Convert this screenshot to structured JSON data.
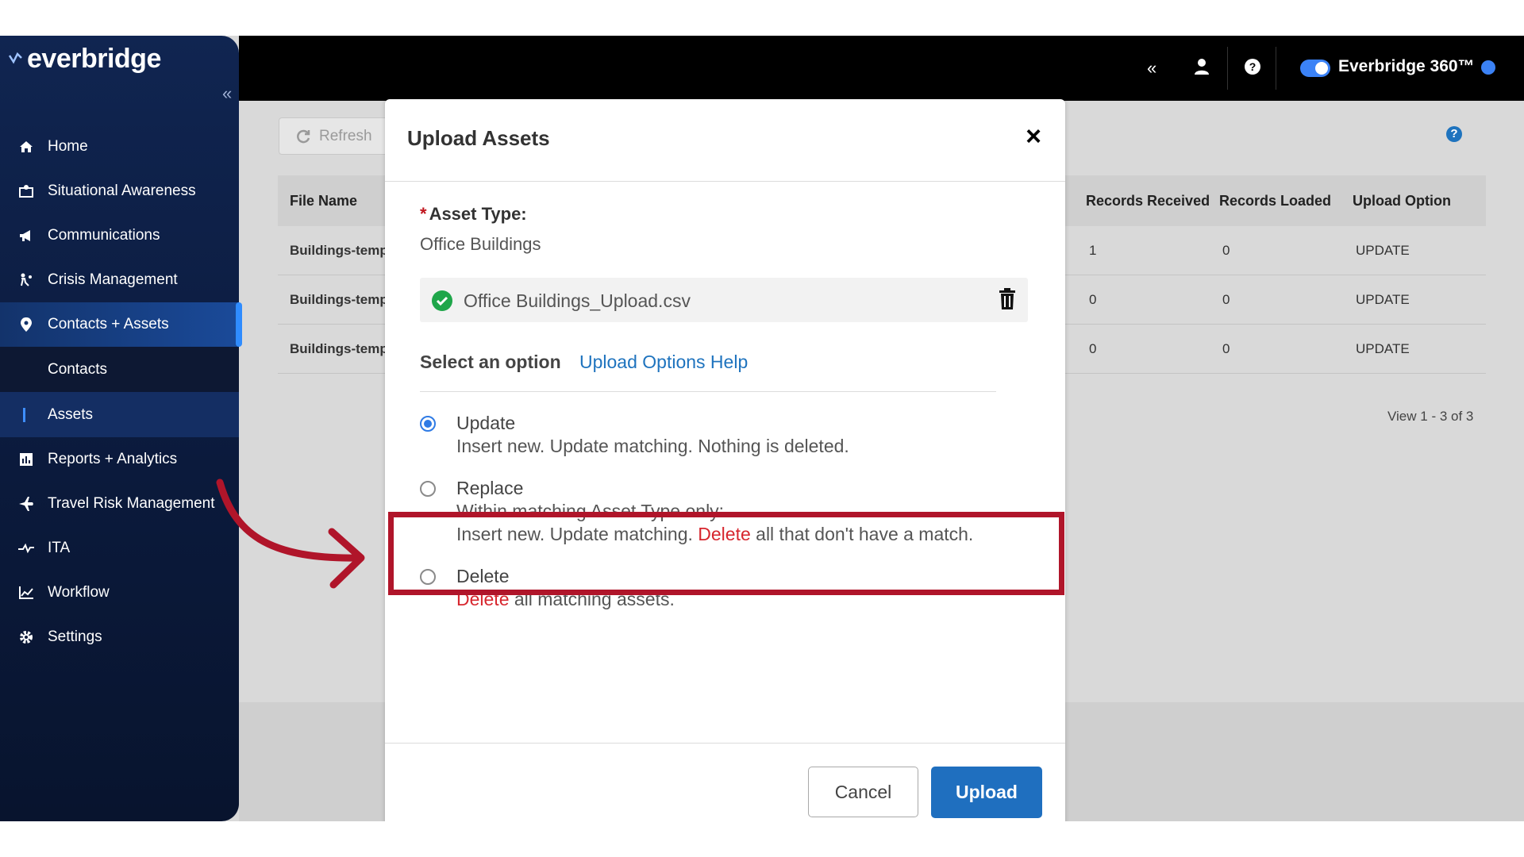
{
  "brand": {
    "logo_text": "everbridge"
  },
  "sidebar": {
    "collapse_glyph": "«",
    "items": [
      {
        "label": "Home",
        "icon": "home-icon"
      },
      {
        "label": "Situational Awareness",
        "icon": "map-icon"
      },
      {
        "label": "Communications",
        "icon": "megaphone-icon"
      },
      {
        "label": "Crisis Management",
        "icon": "crisis-icon"
      },
      {
        "label": "Contacts + Assets",
        "icon": "location-pin-icon",
        "active": true
      },
      {
        "label": "Contacts",
        "sub": true
      },
      {
        "label": "Assets",
        "sub": true,
        "selected": true
      },
      {
        "label": "Reports + Analytics",
        "icon": "report-icon"
      },
      {
        "label": "Travel Risk Management",
        "icon": "airplane-icon"
      },
      {
        "label": "ITA",
        "icon": "ita-icon"
      },
      {
        "label": "Workflow",
        "icon": "workflow-icon"
      },
      {
        "label": "Settings",
        "icon": "gear-icon"
      }
    ]
  },
  "topbar": {
    "collapse_glyph": "«",
    "product_name": "Everbridge 360™",
    "toggle_on": true
  },
  "page": {
    "refresh_label": "Refresh",
    "view_count": "View 1 - 3 of 3",
    "table": {
      "columns": [
        "File Name",
        "Records Received",
        "Records Loaded",
        "Upload Option"
      ],
      "rows": [
        {
          "file": "Buildings-temp",
          "received": "1",
          "loaded": "0",
          "option": "UPDATE"
        },
        {
          "file": "Buildings-temp",
          "received": "0",
          "loaded": "0",
          "option": "UPDATE"
        },
        {
          "file": "Buildings-temp",
          "received": "0",
          "loaded": "0",
          "option": "UPDATE"
        }
      ]
    }
  },
  "modal": {
    "title": "Upload Assets",
    "close_glyph": "×",
    "required_mark": "*",
    "asset_type_label": "Asset Type:",
    "asset_type_value": "Office Buildings",
    "file_name": "Office Buildings_Upload.csv",
    "select_option_label": "Select an option",
    "options_help_link": "Upload Options Help",
    "options": [
      {
        "title": "Update",
        "selected": true,
        "lines": [
          {
            "text": "Insert new. Update matching. Nothing is deleted."
          }
        ]
      },
      {
        "title": "Replace",
        "selected": false,
        "lines": [
          {
            "text": "Within matching Asset Type only:"
          },
          {
            "pre": "Insert new. Update matching. ",
            "red": "Delete",
            "post": " all that don't have a match."
          }
        ]
      },
      {
        "title": "Delete",
        "selected": false,
        "lines": [
          {
            "pre": "",
            "red": "Delete",
            "post": " all matching assets."
          }
        ]
      }
    ],
    "cancel_label": "Cancel",
    "upload_label": "Upload"
  },
  "colors": {
    "sidebar_bg": "#0b1a3c",
    "accent_blue": "#1f6fbf",
    "highlight_red": "#b0152a",
    "delete_red": "#d7262e",
    "success_green": "#1fa64a"
  }
}
